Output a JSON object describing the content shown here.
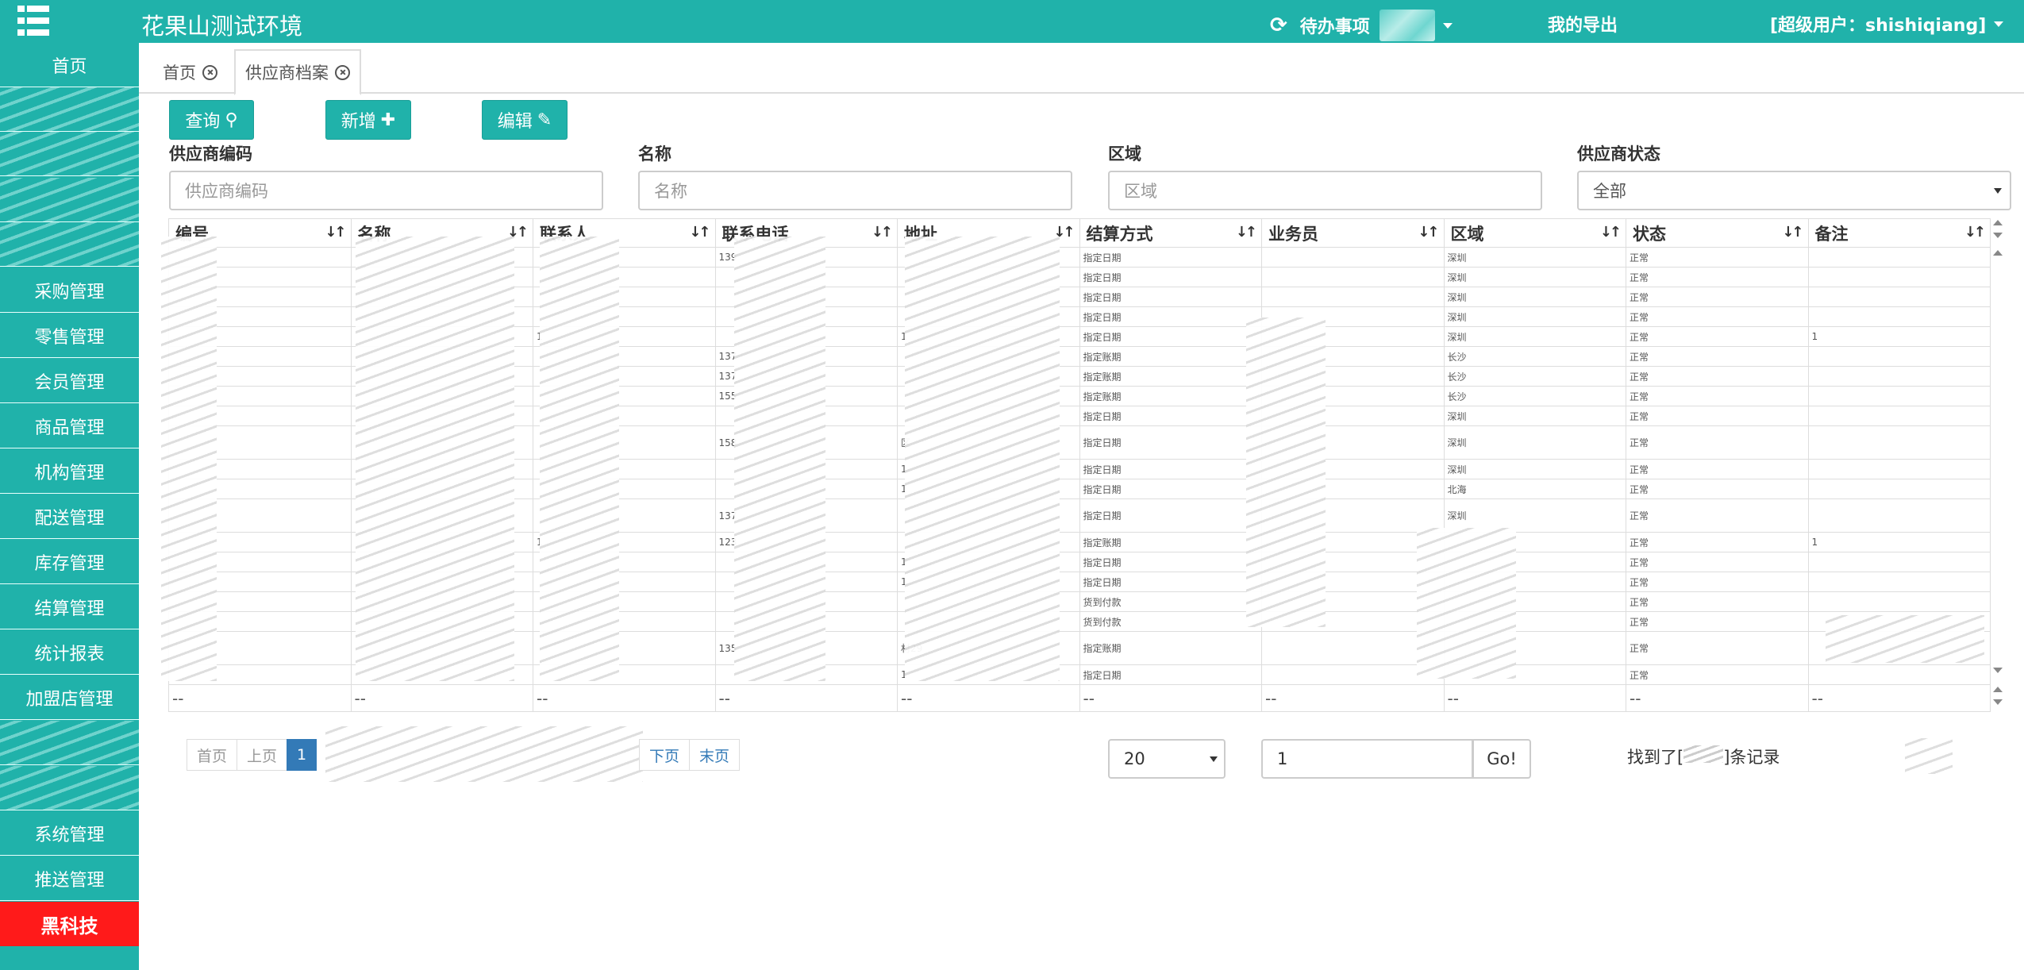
{
  "header": {
    "app_title": "花果山测试环境",
    "todo_label": "待办事项",
    "export_label": "我的导出",
    "user_label": "[超级用户：shishiqiang]"
  },
  "sidebar": {
    "items": [
      {
        "label": "首页"
      },
      {
        "label": "采购管理"
      },
      {
        "label": "零售管理"
      },
      {
        "label": "会员管理"
      },
      {
        "label": "商品管理"
      },
      {
        "label": "机构管理"
      },
      {
        "label": "配送管理"
      },
      {
        "label": "库存管理"
      },
      {
        "label": "结算管理"
      },
      {
        "label": "统计报表"
      },
      {
        "label": "加盟店管理"
      },
      {
        "label": "系统管理"
      },
      {
        "label": "推送管理"
      },
      {
        "label": "黑科技"
      }
    ]
  },
  "tabs": [
    {
      "label": "首页"
    },
    {
      "label": "供应商档案"
    }
  ],
  "toolbar": {
    "query_label": "查询",
    "add_label": "新增",
    "edit_label": "编辑"
  },
  "filters": {
    "code_label": "供应商编码",
    "code_placeholder": "供应商编码",
    "name_label": "名称",
    "name_placeholder": "名称",
    "region_label": "区域",
    "region_placeholder": "区域",
    "status_label": "供应商状态",
    "status_value": "全部"
  },
  "table": {
    "columns": [
      "编号",
      "名称",
      "联系人",
      "联系电话",
      "地址",
      "结算方式",
      "业务员",
      "区域",
      "状态",
      "备注"
    ],
    "rows": [
      {
        "contact": "",
        "phone": "139",
        "address": "",
        "settle": "指定日期",
        "region": "深圳",
        "status": "正常",
        "note": "",
        "tall": false
      },
      {
        "contact": "",
        "phone": "",
        "address": "",
        "settle": "指定日期",
        "region": "深圳",
        "status": "正常",
        "note": "",
        "tall": false
      },
      {
        "contact": "",
        "phone": "",
        "address": "",
        "settle": "指定日期",
        "region": "深圳",
        "status": "正常",
        "note": "",
        "tall": false
      },
      {
        "contact": "",
        "phone": "",
        "address": "",
        "settle": "指定日期",
        "region": "深圳",
        "status": "正常",
        "note": "",
        "tall": false
      },
      {
        "contact": "1",
        "phone": "",
        "address": "1",
        "settle": "指定日期",
        "region": "深圳",
        "status": "正常",
        "note": "1",
        "tall": false
      },
      {
        "contact": "",
        "phone": "137",
        "address": "",
        "settle": "指定账期",
        "region": "长沙",
        "status": "正常",
        "note": "",
        "tall": false
      },
      {
        "contact": "",
        "phone": "137",
        "address": "",
        "settle": "指定账期",
        "region": "长沙",
        "status": "正常",
        "note": "",
        "tall": false
      },
      {
        "contact": "",
        "phone": "155",
        "address": "",
        "settle": "指定账期",
        "region": "长沙",
        "status": "正常",
        "note": "",
        "tall": false
      },
      {
        "contact": "",
        "phone": "",
        "address": "",
        "settle": "指定日期",
        "region": "深圳",
        "status": "正常",
        "note": "",
        "tall": false
      },
      {
        "contact": "",
        "phone": "158",
        "address": "区",
        "settle": "指定日期",
        "region": "深圳",
        "status": "正常",
        "note": "",
        "tall": true
      },
      {
        "contact": "",
        "phone": "",
        "address": "1",
        "settle": "指定日期",
        "region": "深圳",
        "status": "正常",
        "note": "",
        "tall": false
      },
      {
        "contact": "",
        "phone": "",
        "address": "1",
        "settle": "指定日期",
        "region": "北海",
        "status": "正常",
        "note": "",
        "tall": false
      },
      {
        "contact": "",
        "phone": "137",
        "address": "",
        "settle": "指定日期",
        "region": "深圳",
        "status": "正常",
        "note": "",
        "tall": true
      },
      {
        "contact": "1",
        "phone": "123",
        "address": "",
        "settle": "指定账期",
        "region": "",
        "status": "正常",
        "note": "1",
        "tall": false
      },
      {
        "contact": "",
        "phone": "",
        "address": "1",
        "settle": "指定日期",
        "region": "",
        "status": "正常",
        "note": "",
        "tall": false
      },
      {
        "contact": "",
        "phone": "",
        "address": "1",
        "settle": "指定日期",
        "region": "",
        "status": "正常",
        "note": "",
        "tall": false
      },
      {
        "contact": "",
        "phone": "",
        "address": "",
        "settle": "货到付款",
        "region": "",
        "status": "正常",
        "note": "",
        "tall": false
      },
      {
        "contact": "",
        "phone": "",
        "address": "",
        "settle": "货到付款",
        "region": "",
        "status": "正常",
        "note": "",
        "tall": false
      },
      {
        "contact": "",
        "phone": "135",
        "address": "村29",
        "settle": "指定账期",
        "region": "",
        "status": "正常",
        "note": "",
        "tall": true
      },
      {
        "contact": "",
        "phone": "",
        "address": "1",
        "settle": "指定日期",
        "region": "",
        "status": "正常",
        "note": "",
        "tall": false
      }
    ],
    "footer_cell": "--"
  },
  "pagination": {
    "first": "首页",
    "prev": "上页",
    "current": "1",
    "next": "下页",
    "last": "末页",
    "page_size": "20",
    "jump_value": "1",
    "go_label": "Go!",
    "count_prefix": "找到了[",
    "count_suffix": "]条记录"
  },
  "colors": {
    "brand": "#20b2aa",
    "danger": "#ff1a1a",
    "pager_active": "#337ab7"
  },
  "icons": [
    "menu-grid-icon",
    "refresh-icon",
    "search-icon",
    "plus-icon",
    "pencil-icon",
    "close-circle-icon",
    "sort-icon"
  ]
}
